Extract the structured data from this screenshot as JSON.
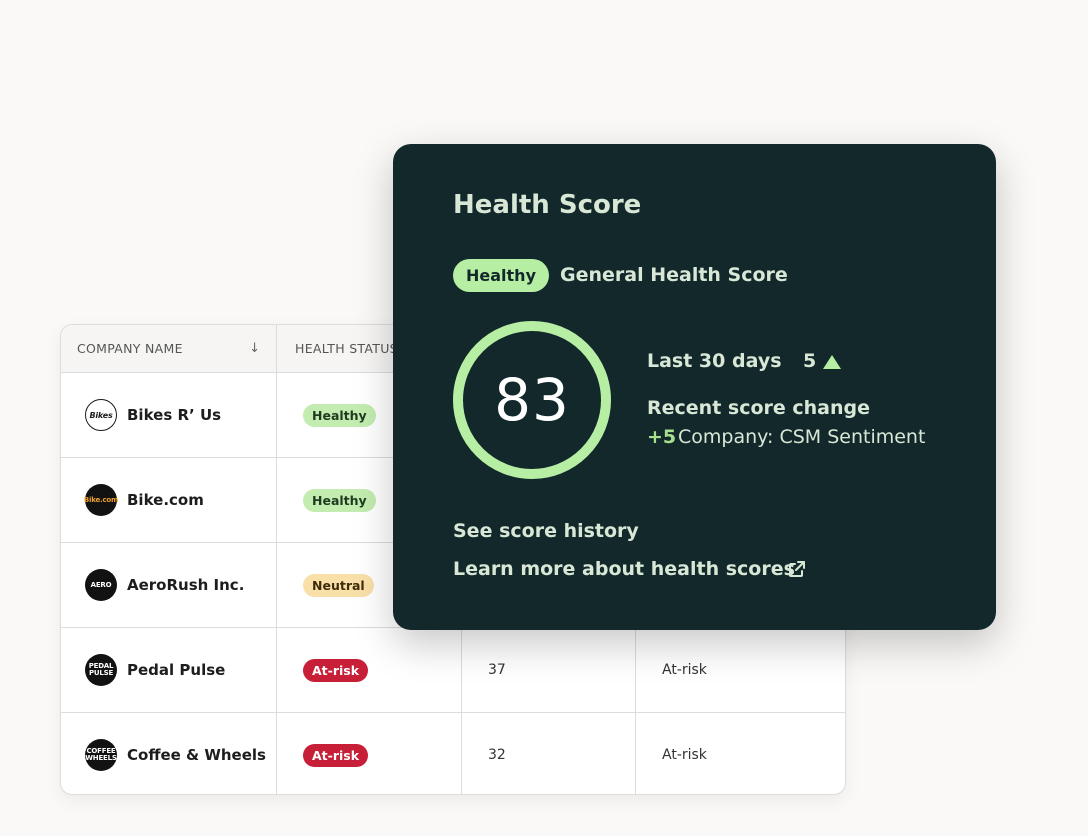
{
  "table": {
    "columns": [
      {
        "label": "COMPANY NAME",
        "sort_icon": "↓"
      },
      {
        "label": "HEALTH STATUS"
      }
    ],
    "rows": [
      {
        "company": "Bikes R’ Us",
        "logo_text": "Bikes",
        "status": "Healthy",
        "status_type": "healthy",
        "score": "",
        "score_label": ""
      },
      {
        "company": "Bike.com",
        "logo_text": "Bike.com",
        "status": "Healthy",
        "status_type": "healthy",
        "score": "",
        "score_label": ""
      },
      {
        "company": "AeroRush Inc.",
        "logo_text": "AERO",
        "status": "Neutral",
        "status_type": "neutral",
        "score": "",
        "score_label": ""
      },
      {
        "company": "Pedal Pulse",
        "logo_text": "PEDAL PULSE",
        "status": "At-risk",
        "status_type": "atrisk",
        "score": "37",
        "score_label": "At-risk"
      },
      {
        "company": "Coffee & Wheels",
        "logo_text": "COFFEE WHEELS",
        "status": "At-risk",
        "status_type": "atrisk",
        "score": "32",
        "score_label": "At-risk"
      }
    ]
  },
  "popover": {
    "title": "Health Score",
    "badge": "Healthy",
    "subtitle": "General Health Score",
    "score": "83",
    "score_ring_fraction": 1.0,
    "last_label": "Last 30 days",
    "last_value": "5",
    "trend_icon": "triangle-up-icon",
    "recent_label": "Recent score change",
    "delta": "+5",
    "delta_desc": "Company: CSM Sentiment",
    "link_history": "See score history",
    "link_learn": "Learn more about health scores",
    "external_icon": "external-link-icon"
  },
  "colors": {
    "popover_bg": "#12282a",
    "accent_green": "#b6eea3",
    "healthy_badge": "#c3ecb0",
    "neutral_badge": "#f9e0a9",
    "atrisk_badge": "#c71f37"
  }
}
